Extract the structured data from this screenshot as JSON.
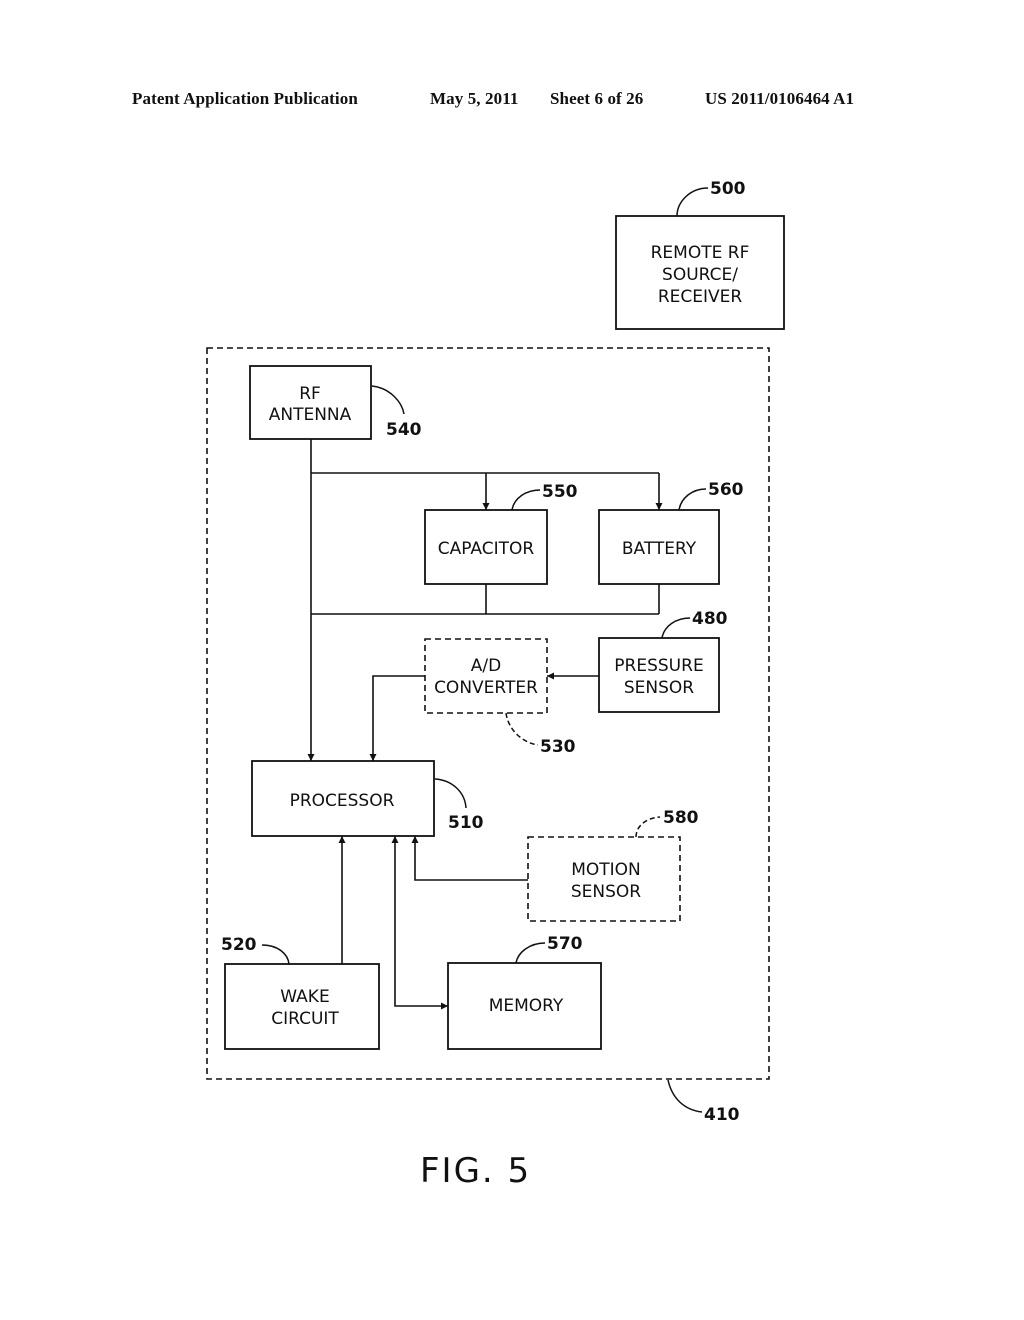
{
  "header": {
    "publication": "Patent Application Publication",
    "date": "May 5, 2011",
    "sheet": "Sheet 6 of 26",
    "number": "US 2011/0106464 A1"
  },
  "figure": {
    "caption": "FIG. 5",
    "enclosure": {
      "ref": "410"
    },
    "blocks": {
      "remote": {
        "lines": [
          "REMOTE  RF",
          "SOURCE/",
          "RECEIVER"
        ],
        "ref": "500",
        "style": "solid"
      },
      "antenna": {
        "lines": [
          "RF",
          "ANTENNA"
        ],
        "ref": "540",
        "style": "solid"
      },
      "capacitor": {
        "lines": [
          "CAPACITOR"
        ],
        "ref": "550",
        "style": "solid"
      },
      "battery": {
        "lines": [
          "BATTERY"
        ],
        "ref": "560",
        "style": "solid"
      },
      "pressure": {
        "lines": [
          "PRESSURE",
          "SENSOR"
        ],
        "ref": "480",
        "style": "solid"
      },
      "adc": {
        "lines": [
          "A/D",
          "CONVERTER"
        ],
        "ref": "530",
        "style": "dashed"
      },
      "processor": {
        "lines": [
          "PROCESSOR"
        ],
        "ref": "510",
        "style": "solid"
      },
      "motion": {
        "lines": [
          "MOTION",
          "SENSOR"
        ],
        "ref": "580",
        "style": "dashed"
      },
      "wake": {
        "lines": [
          "WAKE",
          "CIRCUIT"
        ],
        "ref": "520",
        "style": "solid"
      },
      "memory": {
        "lines": [
          "MEMORY"
        ],
        "ref": "570",
        "style": "solid"
      }
    }
  }
}
